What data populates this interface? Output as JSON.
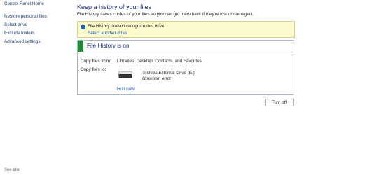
{
  "sidebar": {
    "items": [
      {
        "label": "Control Panel Home"
      },
      {
        "label": "Restore personal files"
      },
      {
        "label": "Select drive"
      },
      {
        "label": "Exclude folders"
      },
      {
        "label": "Advanced settings"
      }
    ],
    "see_also": "See also"
  },
  "main": {
    "title": "Keep a history of your files",
    "description": "File History saves copies of your files so you can get them back if they're lost or damaged.",
    "info_bar": {
      "icon": "info-icon",
      "message": "File History doesn't recognize this drive.",
      "link": "Select another drive"
    },
    "status": {
      "title": "File History is on",
      "accent_color": "#1e8d33",
      "copy_from_label": "Copy files from:",
      "copy_from_value": "Libraries, Desktop, Contacts, and Favorites",
      "copy_to_label": "Copy files to:",
      "drive": {
        "icon": "external-drive-icon",
        "name": "Toshiba External Drive (E:)",
        "status": "Unknown error"
      },
      "run_now": "Run now"
    },
    "turn_off_label": "Turn off"
  }
}
